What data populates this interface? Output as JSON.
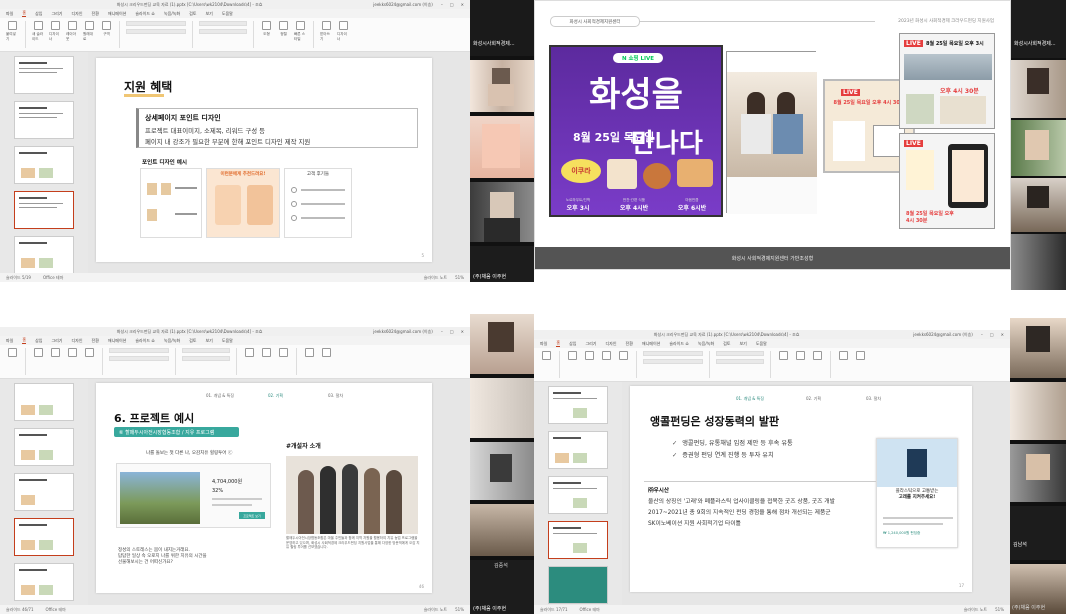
{
  "ppt_tl": {
    "title": "화성시 크리우드펀딩 교육 자료 (1).pptx [C:\\Users\\wk2104\\Downloads\\4] - 조효",
    "account": "jeekks6024@gmail.com (이승)",
    "tabs": [
      "파일",
      "홈",
      "삽입",
      "그리기",
      "디자인",
      "전환",
      "애니메이션",
      "슬라이드 쇼",
      "녹음/녹화",
      "검토",
      "보기",
      "도움말"
    ],
    "active_tab": "홈",
    "ribbon": [
      "붙여넣기",
      "새 슬라이드",
      "디자이너",
      "레이아웃",
      "원래대로",
      "구역",
      "도형",
      "정렬",
      "빠른 스타일",
      "받아쓰기",
      "디자이너"
    ],
    "status_left": "슬라이드 5/19",
    "status_lang": "Office 테마",
    "status_right": "슬라이드 노트",
    "zoom": "51%",
    "slide_page": "5",
    "slide": {
      "title": "지원 혜택",
      "box_heading": "상세페이지 포인트 디자인",
      "box_line1": "프로젝트 대표이미지, 소제목, 리워드 구성 등",
      "box_line2": "페이지 내 강조가 필요한 부분에 한해 포인트 디자인 제작 지원",
      "sub_heading": "포인트 디자인 예시",
      "card2": "이런분에게 추천드려요!",
      "card3": "고객 후기들"
    }
  },
  "tr": {
    "pill": "화성시 사회적경제지원센터",
    "top_right": "2023년 화성시 사회적경제 크라우드펀딩 지원사업",
    "footer": "화성시 사회적경제지원센터 가반조성형",
    "poster": {
      "logo": "N 쇼핑 LIVE",
      "line1": "화성을",
      "line2": "만나다",
      "date": "8월 25일 목요일",
      "badge": "이쿠라",
      "times": [
        {
          "label": "오후 3시",
          "sub": "노르하우트/진학"
        },
        {
          "label": "오후 4시반",
          "sub": "반찬·간편 식품"
        },
        {
          "label": "오후 6시반",
          "sub": "마음만큼"
        }
      ]
    },
    "live": "LIVE",
    "card_a": "8월 25일 목요일 오후 4시 30분",
    "card_b": "8월 25일 목요일 오후 3시",
    "card_c": "8월 25일 목요일 오후 4시 30분",
    "card_b2": "오후 4시 30분"
  },
  "ppt_bl": {
    "title": "화성시 크리우드펀딩 교육 자료 (1).pptx [C:\\Users\\wk2104\\Downloads\\4] - 조효",
    "account": "jeekks6024@gmail.com (이승)",
    "tabs": [
      "파일",
      "홈",
      "삽입",
      "그리기",
      "디자인",
      "전환",
      "애니메이션",
      "슬라이드 쇼",
      "녹음/녹화",
      "검토",
      "보기",
      "도움말"
    ],
    "active_tab": "홈",
    "status_left": "슬라이드 46/71",
    "status_lang": "Office 테마",
    "status_right": "슬라이드 노트",
    "zoom": "51%",
    "slide_page": "46",
    "slide": {
      "nav": [
        "01. 개념 & 특징",
        "02. 기획",
        "03. 절차"
      ],
      "title": "6. 프로젝트 예시",
      "pill": "⑥ 할매두시아전시장협동조합 / 지유 프로그램",
      "mid": "나를 돌보는 첫 다른 나, 오감치유 힐링투어 ⓒ",
      "price": "4,704,000원",
      "pct": "32%",
      "btn": "프로젝트 보기",
      "caption1": "정성의 스토레스는 몸이 내지는거래요.",
      "caption2": "답답한 일상 속 오로지 나를 위한 치유의 시간을",
      "caption3": "선물해보시는 건 어떠신가요?",
      "hash": "#개설자 소개",
      "para": "할매두시아전시장협동조합은 마을 주민들과 함께 지역 자원을 활용하여 치유 농업 프로그램을 운영하고 있으며, 화성시 사회적경제 크라우드펀딩 지원사업을 통해 다양한 방문객에게 오감 치유 힐링 투어를 선보였습니다."
    }
  },
  "ppt_br": {
    "title": "화성시 크리우드펀딩 교육 자료 (1).pptx [C:\\Users\\wk2104\\Downloads\\4] - 조효",
    "account": "jeekks6024@gmail.com (이승)",
    "tabs": [
      "파일",
      "홈",
      "삽입",
      "그리기",
      "디자인",
      "전환",
      "애니메이션",
      "슬라이드 쇼",
      "녹음/녹화",
      "검토",
      "보기",
      "도움말"
    ],
    "active_tab": "홈",
    "status_left": "슬라이드 17/71",
    "status_lang": "Office 테마",
    "status_right": "슬라이드 노트",
    "zoom": "51%",
    "slide_page": "17",
    "slide": {
      "nav": [
        "01. 개념 & 특징",
        "02. 기획",
        "03. 절차"
      ],
      "title": "앵콜펀딩은 성장동력의 발판",
      "bullet1": "앵콜펀딩, 유통채널 입점 제안 등 후속 유통",
      "bullet2": "증권형 펀딩 연계 진행 등 투자 유치",
      "case_heading": "㈜우시산",
      "case1": "울산의 상징인 '고래'와 폐플라스틱 업사이클링을 접목한 굿즈 상품, 굿즈 개발",
      "case2": "2017~2021년 총 9회의 지속적인 펀딩 경험을 통해 점차 개선되는 제품군",
      "case3": "SK이노베이션 지원 사회적기업 타이틀",
      "card_text1": "플라스틱으로 고통받는",
      "card_text2": "고래를 지켜주세요!",
      "card_amount": "₩ 1,240,000원 펀딩중"
    }
  },
  "tiles": {
    "name_mid_top": "화성시사회적경제...",
    "name_mid_bottom": "(주)채움 이주현",
    "name_right_top": "화성시사회적경제...",
    "name_bl": "(주)채움 이주현",
    "name_br_a": "김중석",
    "name_br_b": "김남석",
    "name_br_c": "(주)채움 이주현"
  }
}
